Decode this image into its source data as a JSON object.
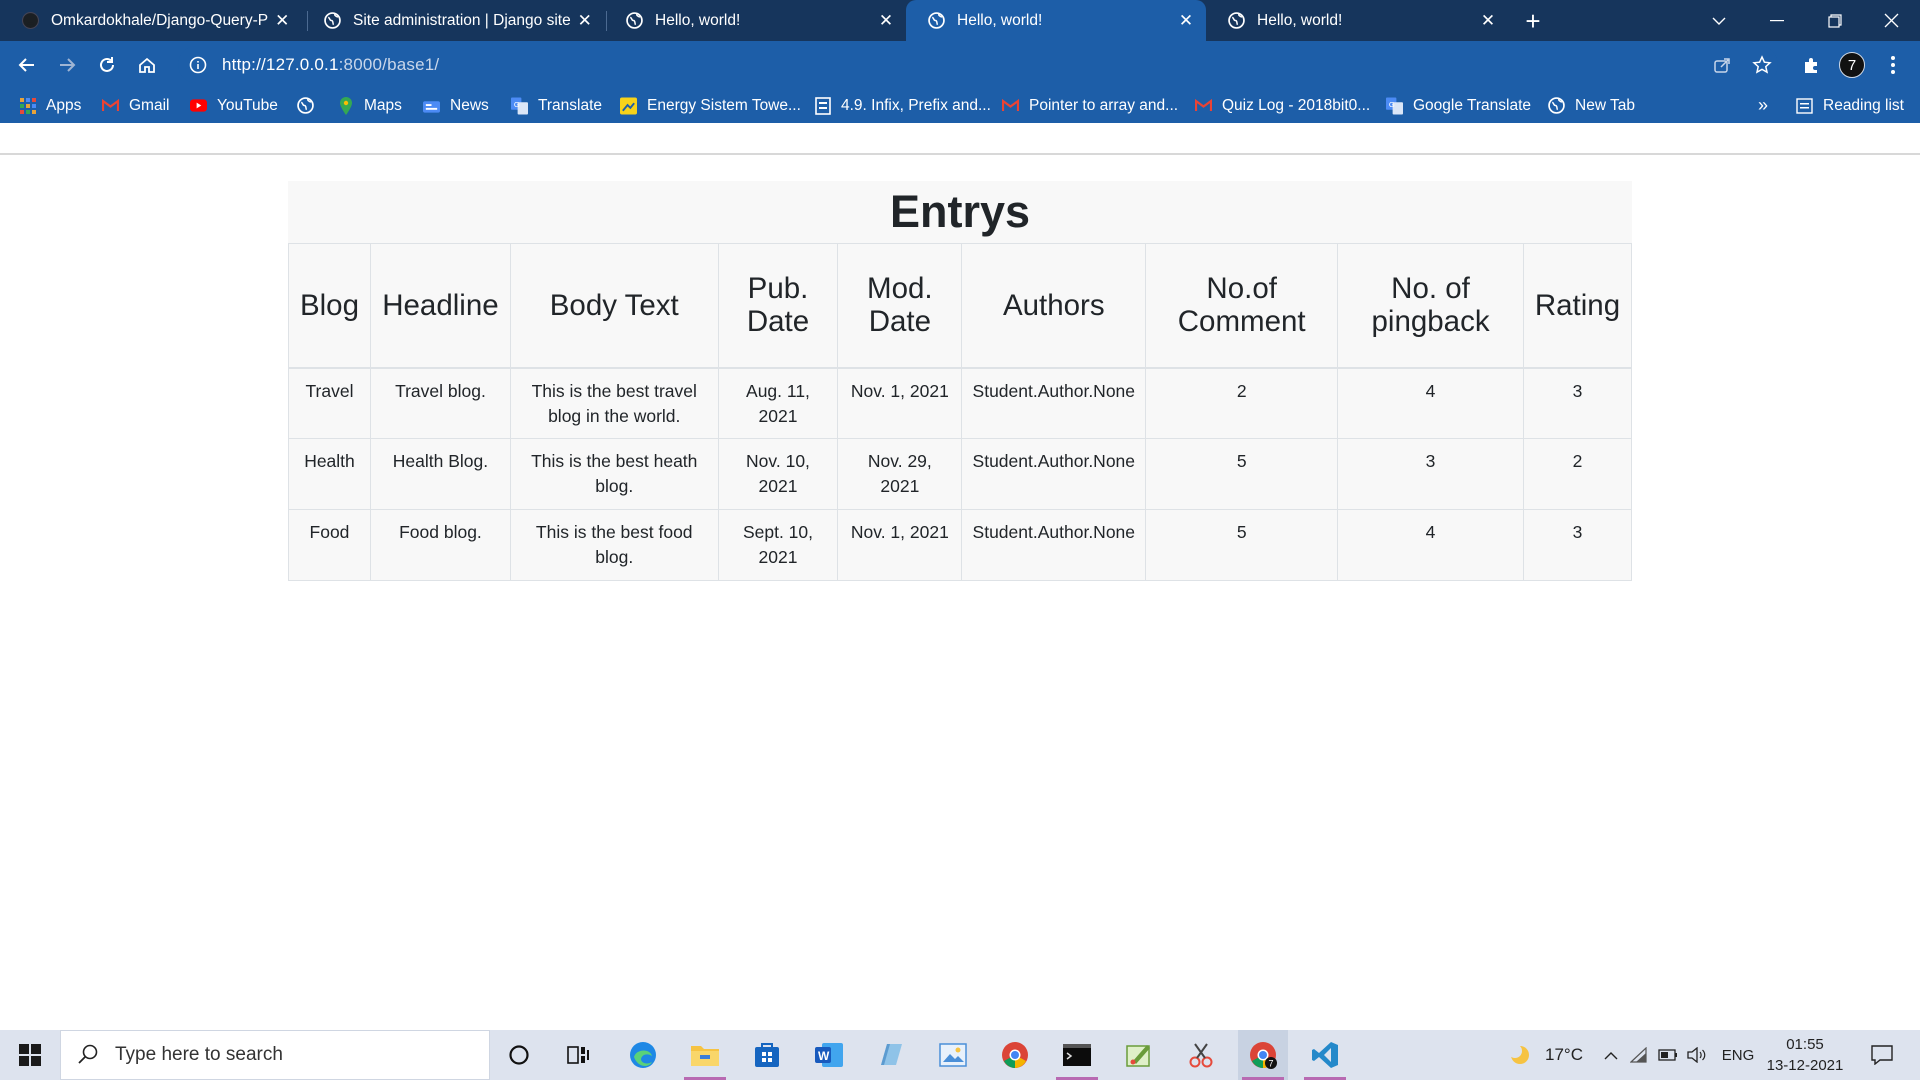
{
  "browser": {
    "tabs": [
      {
        "title": "Omkardokhale/Django-Query-Pr",
        "icon": "github-icon",
        "active": false
      },
      {
        "title": "Site administration | Django site a",
        "icon": "globe-icon",
        "active": false
      },
      {
        "title": "Hello, world!",
        "icon": "globe-icon",
        "active": false
      },
      {
        "title": "Hello, world!",
        "icon": "globe-icon",
        "active": true
      },
      {
        "title": "Hello, world!",
        "icon": "globe-icon",
        "active": false
      }
    ],
    "new_tab": "+",
    "url_host": "http://127.0.0.1",
    "url_rest": ":8000/base1/",
    "profile_initial": "7",
    "bookmarks": [
      {
        "label": "Apps",
        "icon": "apps-grid-icon"
      },
      {
        "label": "Gmail",
        "icon": "gmail-icon"
      },
      {
        "label": "YouTube",
        "icon": "youtube-icon"
      },
      {
        "label": "",
        "icon": "globe-icon"
      },
      {
        "label": "Maps",
        "icon": "maps-pin-icon"
      },
      {
        "label": "News",
        "icon": "news-icon"
      },
      {
        "label": "Translate",
        "icon": "translate-icon"
      },
      {
        "label": "Energy Sistem Towe...",
        "icon": "bookmark-page-icon"
      },
      {
        "label": "4.9. Infix, Prefix and...",
        "icon": "document-icon"
      },
      {
        "label": "Pointer to array and...",
        "icon": "gmail-icon"
      },
      {
        "label": "Quiz Log - 2018bit0...",
        "icon": "gmail-icon"
      },
      {
        "label": "Google Translate",
        "icon": "translate-icon"
      },
      {
        "label": "New Tab",
        "icon": "globe-icon"
      }
    ],
    "overflow": "»",
    "reading_list": "Reading list"
  },
  "page": {
    "heading": "Entrys",
    "columns": [
      "Blog",
      "Headline",
      "Body Text",
      "Pub. Date",
      "Mod. Date",
      "Authors",
      "No.of Comment",
      "No. of pingback",
      "Rating"
    ],
    "rows": [
      [
        "Travel",
        "Travel blog.",
        "This is the best travel blog in the world.",
        "Aug. 11, 2021",
        "Nov. 1, 2021",
        "Student.Author.None",
        "2",
        "4",
        "3"
      ],
      [
        "Health",
        "Health Blog.",
        "This is the best heath blog.",
        "Nov. 10, 2021",
        "Nov. 29, 2021",
        "Student.Author.None",
        "5",
        "3",
        "2"
      ],
      [
        "Food",
        "Food blog.",
        "This is the best food blog.",
        "Sept. 10, 2021",
        "Nov. 1, 2021",
        "Student.Author.None",
        "5",
        "4",
        "3"
      ]
    ]
  },
  "taskbar": {
    "search_placeholder": "Type here to search",
    "weather": "17°C",
    "language": "ENG",
    "time": "01:55",
    "date": "13-12-2021"
  },
  "colors": {
    "tab_strip": "#16355c",
    "toolbar": "#1d5ea8",
    "table_bg": "#f8f8f8",
    "taskbar": "#dde3ee"
  }
}
